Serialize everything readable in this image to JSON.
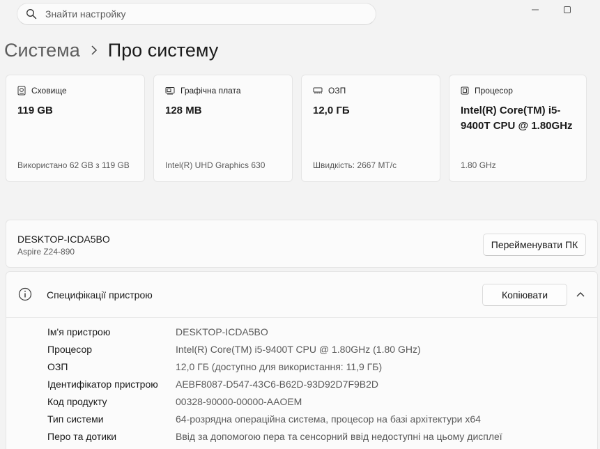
{
  "search": {
    "placeholder": "Знайти настройку",
    "icon": "search-icon"
  },
  "breadcrumb": {
    "parent": "Система",
    "separator_icon": "chevron-right-icon",
    "current": "Про систему"
  },
  "cards": [
    {
      "label": "Сховище",
      "icon": "storage-icon",
      "value": "119 GB",
      "sub": "Використано 62 GB з 119 GB"
    },
    {
      "label": "Графічна плата",
      "icon": "display-adapter-icon",
      "value": "128 MB",
      "sub": "Intel(R) UHD Graphics 630"
    },
    {
      "label": "ОЗП",
      "icon": "ram-icon",
      "value": "12,0 ГБ",
      "sub": "Швидкість: 2667 МТ/с"
    },
    {
      "label": "Процесор",
      "icon": "processor-icon",
      "value": "Intel(R) Core(TM) i5-9400T CPU @ 1.80GHz",
      "sub": "1.80 GHz"
    }
  ],
  "device": {
    "name": "DESKTOP-ICDA5BO",
    "model": "Aspire Z24-890",
    "rename_label": "Перейменувати ПК"
  },
  "specs": {
    "title": "Специфікації пристрою",
    "copy_label": "Копіювати",
    "rows": [
      {
        "key": "Ім'я пристрою",
        "value": "DESKTOP-ICDA5BO"
      },
      {
        "key": "Процесор",
        "value": "Intel(R) Core(TM) i5-9400T CPU @ 1.80GHz (1.80 GHz)"
      },
      {
        "key": "ОЗП",
        "value": "12,0 ГБ (доступно для використання: 11,9 ГБ)"
      },
      {
        "key": "Ідентифікатор пристрою",
        "value": "AEBF8087-D547-43C6-B62D-93D92D7F9B2D"
      },
      {
        "key": "Код продукту",
        "value": "00328-90000-00000-AAOEM"
      },
      {
        "key": "Тип системи",
        "value": "64-розрядна операційна система, процесор на базі архітектури x64"
      },
      {
        "key": "Перо та дотики",
        "value": "Ввід за допомогою пера та сенсорний ввід недоступні на цьому дисплеї"
      }
    ]
  },
  "colors": {
    "background": "#f3f3f3",
    "card": "#fbfbfb",
    "border": "#e5e5e5",
    "text": "#1a1a1a",
    "secondary_text": "#5a5a5a"
  }
}
